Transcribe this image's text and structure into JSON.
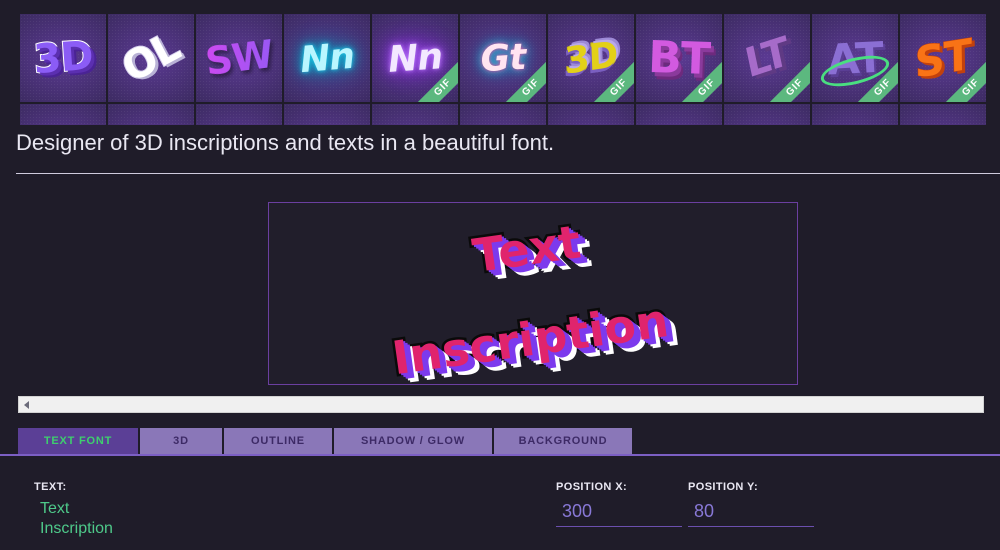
{
  "app": {
    "tagline": "Designer of 3D inscriptions and texts in a beautiful font.",
    "background_color": "#1f1c29",
    "accent_color": "#7c5fc4",
    "active_tab_color": "#5b3f96",
    "active_tab_text_color": "#3ecf6e",
    "tab_color": "#8a77b8"
  },
  "gallery": {
    "row1": [
      {
        "glyph": "3D",
        "style": "g-3dpurple",
        "gif": false,
        "name": "3d-purple-block"
      },
      {
        "glyph": "OL",
        "style": "g-whitepill",
        "gif": false,
        "name": "white-rounded"
      },
      {
        "glyph": "SW",
        "style": "g-gradient",
        "gif": false,
        "name": "magenta-gradient"
      },
      {
        "glyph": "Nn",
        "style": "g-neoncyan",
        "gif": false,
        "name": "neon-cyan-script"
      },
      {
        "glyph": "Nn",
        "style": "g-neonpurple",
        "gif": true,
        "name": "neon-purple-script"
      },
      {
        "glyph": "Gt",
        "style": "g-neonpink",
        "gif": true,
        "name": "neon-pink-script"
      },
      {
        "glyph": "3D",
        "style": "g-gold3d",
        "gif": true,
        "name": "gold-3d-block"
      },
      {
        "glyph": "BT",
        "style": "g-bt",
        "gif": true,
        "name": "pink-3d-caps"
      },
      {
        "glyph": "LT",
        "style": "g-lt",
        "gif": true,
        "name": "shattered-caps"
      },
      {
        "glyph": "AT",
        "style": "g-at",
        "gif": true,
        "name": "orbit-ring-caps"
      },
      {
        "glyph": "ST",
        "style": "g-st",
        "gif": true,
        "name": "orange-broken-caps"
      }
    ],
    "row2": [
      {
        "glyph": "",
        "style": "g-3dpurple",
        "gif": false,
        "name": "preview-partial-1"
      },
      {
        "glyph": "",
        "style": "g-neoncyan",
        "gif": false,
        "name": "preview-partial-2"
      },
      {
        "glyph": "",
        "style": "g-gradient",
        "gif": false,
        "name": "preview-partial-3"
      },
      {
        "glyph": "",
        "style": "g-neoncyan",
        "gif": false,
        "name": "preview-partial-4"
      },
      {
        "glyph": "",
        "style": "g-at",
        "gif": false,
        "name": "preview-partial-5"
      },
      {
        "glyph": "",
        "style": "g-neonpink",
        "gif": false,
        "name": "preview-partial-6"
      },
      {
        "glyph": "",
        "style": "g-gold3d",
        "gif": false,
        "name": "preview-partial-7"
      },
      {
        "glyph": "",
        "style": "g-bt",
        "gif": false,
        "name": "preview-partial-8"
      },
      {
        "glyph": "",
        "style": "g-lt",
        "gif": false,
        "name": "preview-partial-9"
      },
      {
        "glyph": "",
        "style": "g-at",
        "gif": false,
        "name": "preview-partial-10"
      },
      {
        "glyph": "",
        "style": "g-st",
        "gif": false,
        "name": "preview-partial-11"
      }
    ],
    "gif_badge_label": "GIF"
  },
  "canvas": {
    "line1": "Text",
    "line2": "Inscription",
    "fill_color": "#e0246d",
    "outline_color": "#0a0a0a",
    "extrude_color": "#7c3aed",
    "highlight_color": "#ffffff",
    "background_color": "#211e2b",
    "border_color": "#6b3fa0"
  },
  "scrollbar": {
    "left_arrow_icon": "triangle-left-icon"
  },
  "tabs": [
    {
      "label": "TEXT FONT",
      "active": true,
      "name": "tab-text-font"
    },
    {
      "label": "3D",
      "active": false,
      "name": "tab-3d"
    },
    {
      "label": "OUTLINE",
      "active": false,
      "name": "tab-outline"
    },
    {
      "label": "SHADOW / GLOW",
      "active": false,
      "name": "tab-shadow-glow"
    },
    {
      "label": "BACKGROUND",
      "active": false,
      "name": "tab-background"
    }
  ],
  "controls": {
    "text": {
      "label": "TEXT:",
      "value": "Text\nInscription",
      "placeholder": "Text"
    },
    "position_x": {
      "label": "POSITION X:",
      "value": "300",
      "placeholder": "300"
    },
    "position_y": {
      "label": "POSITION Y:",
      "value": "80",
      "placeholder": "80"
    }
  }
}
